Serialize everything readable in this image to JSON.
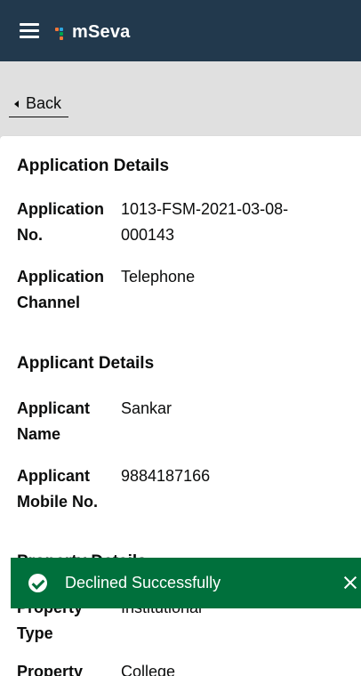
{
  "header": {
    "logo_text": "mSeva",
    "logo_colors": [
      "#f47738",
      "#2ea7e0",
      "#00a44d",
      "#f47738"
    ],
    "background": "#22394d"
  },
  "back": {
    "label": "Back"
  },
  "sections": {
    "application": {
      "title": "Application Details",
      "rows": [
        {
          "label": "Application No.",
          "value": "1013-FSM-2021-03-08-000143"
        },
        {
          "label": "Application Channel",
          "value": "Telephone"
        }
      ]
    },
    "applicant": {
      "title": "Applicant Details",
      "rows": [
        {
          "label": "Applicant Name",
          "value": "Sankar"
        },
        {
          "label": "Applicant Mobile No.",
          "value": "9884187166"
        }
      ]
    },
    "property": {
      "title": "Property Details",
      "rows": [
        {
          "label": "Property Type",
          "value": "Institutional"
        },
        {
          "label": "Property",
          "value": "College"
        }
      ]
    }
  },
  "toast": {
    "message": "Declined Successfully",
    "color": "#00703c"
  }
}
